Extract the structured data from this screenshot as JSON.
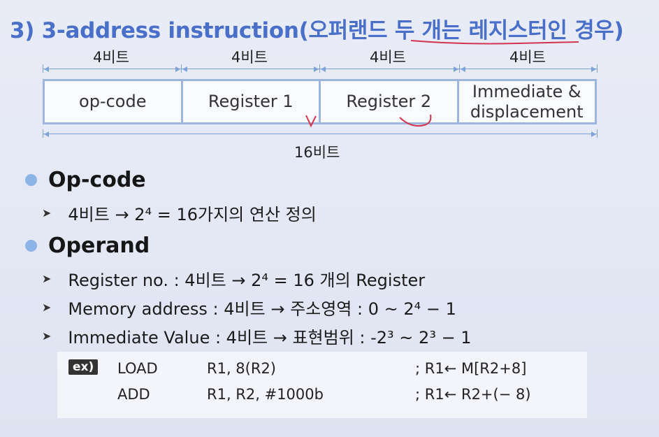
{
  "title": "3) 3-address instruction(오퍼랜드 두 개는 레지스터인 경우)",
  "format": {
    "field_bits": [
      "4비트",
      "4비트",
      "4비트",
      "4비트"
    ],
    "fields": [
      "op-code",
      "Register 1",
      "Register 2",
      "Immediate &\ndisplacement"
    ],
    "total_bits": "16비트"
  },
  "sections": [
    {
      "heading": "Op-code",
      "items": [
        "4비트 → 2⁴ = 16가지의 연산 정의"
      ]
    },
    {
      "heading": "Operand",
      "items": [
        "Register no. : 4비트 → 2⁴ = 16 개의 Register",
        "Memory address : 4비트 → 주소영역 : 0 ~ 2⁴ − 1",
        "Immediate Value : 4비트 → 표현범위 : -2³ ~ 2³ − 1"
      ]
    }
  ],
  "example": {
    "badge": "ex)",
    "lines": [
      {
        "op": "LOAD",
        "args": "R1, 8(R2)",
        "comment": "; R1← M[R2+8]"
      },
      {
        "op": "ADD",
        "args": "R1, R2, #1000b",
        "comment": "; R1← R2+(− 8)"
      }
    ]
  },
  "colors": {
    "title": "#4a6fc9",
    "bullet": "#8db4e6",
    "border": "#9db6df",
    "ink": "#d1344f"
  }
}
